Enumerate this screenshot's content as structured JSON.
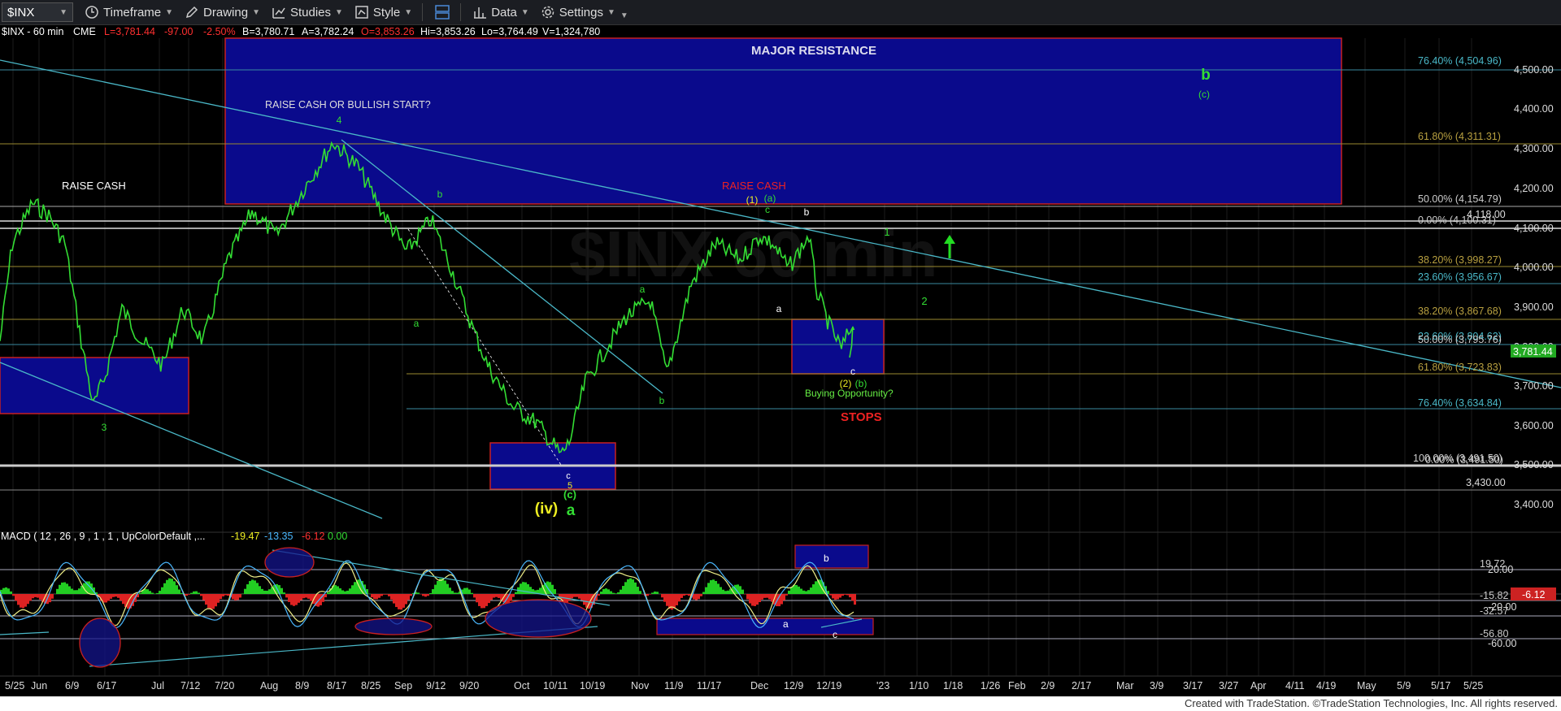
{
  "toolbar": {
    "symbol": "$INX",
    "timeframe": "Timeframe",
    "drawing": "Drawing",
    "studies": "Studies",
    "style": "Style",
    "data": "Data",
    "settings": "Settings"
  },
  "header": {
    "title": "$INX - 60 min",
    "exchange": "CME",
    "last": "L=3,781.44",
    "change": "-97.00",
    "pct": "-2.50%",
    "bid": "B=3,780.71",
    "ask": "A=3,782.24",
    "open": "O=3,853.26",
    "high": "Hi=3,853.26",
    "low": "Lo=3,764.49",
    "volume": "V=1,324,780"
  },
  "price_axis": [
    "4,500.00",
    "4,400.00",
    "4,300.00",
    "4,200.00",
    "4,100.00",
    "4,000.00",
    "3,900.00",
    "3,800.00",
    "3,700.00",
    "3,600.00",
    "3,500.00",
    "3,400.00"
  ],
  "last_price": "3,781.44",
  "fib_labels": [
    "76.40% (4,504.96)",
    "61.80% (4,311.31)",
    "50.00% (4,154.79)",
    "0.00% (4,100.31)",
    "4,118.00",
    "38.20% (3,998.27)",
    "23.60% (3,956.67)",
    "38.20% (3,867.68)",
    "23.60% (3,804.62)",
    "50.00% (3,795.76)",
    "61.80% (3,723.83)",
    "76.40% (3,634.84)",
    "100.00% (3,491.50)",
    "0.00% (3,491.50)",
    "3,430.00"
  ],
  "annotations": {
    "major_resistance": "MAJOR RESISTANCE",
    "raise_cash_or_bullish": "RAISE CASH OR BULLISH START?",
    "raise_cash_left": "RAISE CASH",
    "raise_cash_right": "RAISE CASH",
    "buying_opportunity": "Buying Opportunity?",
    "stops": "STOPS",
    "wave_b_big": "b",
    "wave_c_paren": "(c)",
    "wave_4": "4",
    "wave_3": "3",
    "wave_1_paren": "(1)",
    "wave_a_paren": "(a)",
    "wave_2_paren": "(2)",
    "wave_b_paren": "(b)",
    "wave_iv": "(iv)",
    "wave_a_big": "a",
    "wave_c_circ": "(c)",
    "wave_5": "5",
    "wave_1": "1",
    "wave_2": "2",
    "lbl_b1": "b",
    "lbl_a1": "a",
    "lbl_a2": "a",
    "lbl_b2": "b",
    "lbl_c1": "c",
    "lbl_c2": "c",
    "lbl_b3": "b",
    "lbl_a3": "a",
    "lbl_c3": "c"
  },
  "macd": {
    "title": "MACD ( 12 , 26 , 9 , 1 , 1 , UpColorDefault ,...",
    "v1": "-19.47",
    "v2": "-13.35",
    "v3": "-6.12",
    "v4": "0.00",
    "axis": [
      "20.00",
      "-20.00",
      "-60.00"
    ],
    "levels": [
      "19.72",
      "-15.82",
      "-32.57",
      "-56.80"
    ],
    "last": "-6.12",
    "lbl_b": "b",
    "lbl_a": "a",
    "lbl_c": "c"
  },
  "time_axis": [
    "5/25",
    "Jun",
    "6/9",
    "6/17",
    "Jul",
    "7/12",
    "7/20",
    "Aug",
    "8/9",
    "8/17",
    "8/25",
    "Sep",
    "9/12",
    "9/20",
    "Oct",
    "10/11",
    "10/19",
    "Nov",
    "11/9",
    "11/17",
    "Dec",
    "12/9",
    "12/19",
    "'23",
    "1/10",
    "1/18",
    "1/26",
    "Feb",
    "2/9",
    "2/17",
    "Mar",
    "3/9",
    "3/17",
    "3/27",
    "Apr",
    "4/11",
    "4/19",
    "May",
    "5/9",
    "5/17",
    "5/25"
  ],
  "footer": "Created with TradeStation. ©TradeStation Technologies, Inc. All rights reserved.",
  "colors": {
    "price": "#33dd33",
    "resistance_box": "#0a0a8c",
    "trendline": "#4ab8c8",
    "fib_text": "#4ab8c8",
    "red": "#ee2222",
    "yellow": "#eeee22"
  }
}
